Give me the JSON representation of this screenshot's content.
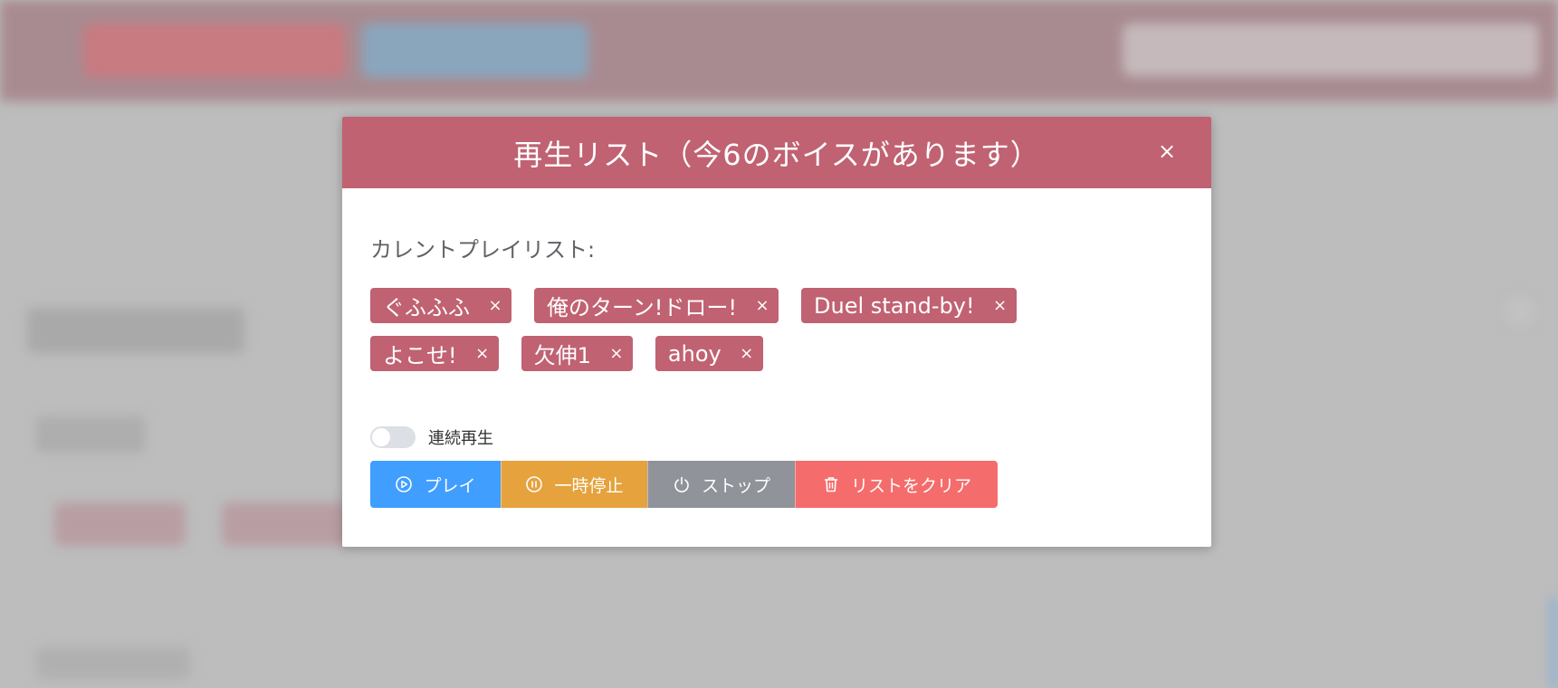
{
  "modal": {
    "title": "再生リスト（今6のボイスがあります）",
    "close_icon": "close-icon",
    "header_color": "#c06272"
  },
  "playlist": {
    "label": "カレントプレイリスト:",
    "items": [
      {
        "label": "ぐふふふ"
      },
      {
        "label": "俺のターン!ドロー!"
      },
      {
        "label": "Duel stand-by!"
      },
      {
        "label": "よこせ!"
      },
      {
        "label": "欠伸1"
      },
      {
        "label": "ahoy"
      }
    ],
    "remove_icon": "close-icon"
  },
  "controls": {
    "continuous_label": "連続再生",
    "continuous_on": false,
    "buttons": [
      {
        "label": "プレイ",
        "icon": "play-circle-icon",
        "color": "#409eff"
      },
      {
        "label": "一時停止",
        "icon": "pause-circle-icon",
        "color": "#e6a23c"
      },
      {
        "label": "ストップ",
        "icon": "power-icon",
        "color": "#909399"
      },
      {
        "label": "リストをクリア",
        "icon": "trash-icon",
        "color": "#f56c6c"
      }
    ]
  }
}
